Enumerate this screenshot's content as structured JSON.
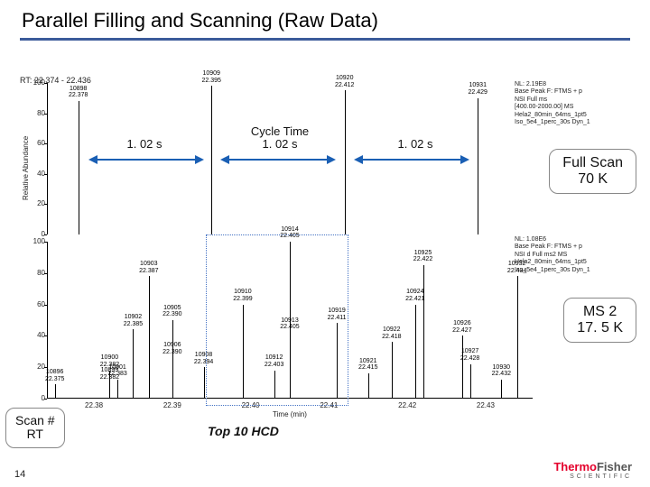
{
  "title": "Parallel Filling and Scanning (Raw Data)",
  "rt_range": "RT: 22.374 - 22.436",
  "ylabel": "Relative Abundance",
  "xlabel": "Time (min)",
  "cycle_label": "Cycle Time",
  "cycle_times": [
    "1. 02 s",
    "1. 02 s",
    "1. 02 s"
  ],
  "pills": {
    "fullscan": "Full Scan\n70 K",
    "ms2": "MS 2\n17. 5 K"
  },
  "scan_rt": "Scan #\nRT",
  "top10": "Top 10 HCD",
  "page_num": "14",
  "logo": {
    "thermo": "Thermo",
    "fisher": "Fisher",
    "sci": "SCIENTIFIC"
  },
  "info_top": "NL: 2.19E8\nBase Peak F: FTMS + p\nNSI Full ms\n[400.00-2000.00]  MS\nHela2_80min_64ms_1pt5\nIso_5e4_1perc_30s Dyn_1",
  "info_bot": "NL: 1.08E6\nBase Peak F: FTMS + p\nNSI d Full ms2  MS\nHela2_80min_64ms_1pt5\nIso_5e4_1perc_30s Dyn_1",
  "chart_data": [
    {
      "type": "bar",
      "xlabel": "Time (min)",
      "ylabel": "Relative Abundance",
      "ylim": [
        0,
        100
      ],
      "yticks": [
        0,
        20,
        40,
        60,
        80,
        100
      ],
      "xticks": [
        22.38,
        22.39,
        22.4,
        22.41,
        22.42,
        22.43
      ],
      "series": [
        {
          "name": "Full Scan 70K",
          "peaks": [
            {
              "scan": 10898,
              "rt": 22.378,
              "abund": 88
            },
            {
              "scan": 10909,
              "rt": 22.395,
              "abund": 98
            },
            {
              "scan": 10920,
              "rt": 22.412,
              "abund": 95
            },
            {
              "scan": 10931,
              "rt": 22.429,
              "abund": 90
            }
          ]
        }
      ]
    },
    {
      "type": "bar",
      "xlabel": "Time (min)",
      "ylabel": "Relative Abundance",
      "ylim": [
        0,
        100
      ],
      "yticks": [
        0,
        20,
        40,
        60,
        80,
        100
      ],
      "xticks": [
        22.38,
        22.39,
        22.4,
        22.41,
        22.42,
        22.43
      ],
      "series": [
        {
          "name": "MS2 17.5K",
          "peaks": [
            {
              "scan": 10896,
              "rt": 22.375,
              "abund": 9
            },
            {
              "scan": 10899,
              "rt": 22.382,
              "abund": 10
            },
            {
              "scan": 10900,
              "rt": 22.382,
              "abund": 18
            },
            {
              "scan": 10901,
              "rt": 22.383,
              "abund": 12
            },
            {
              "scan": 10902,
              "rt": 22.385,
              "abund": 44
            },
            {
              "scan": 10903,
              "rt": 22.387,
              "abund": 78
            },
            {
              "scan": 10905,
              "rt": 22.39,
              "abund": 50
            },
            {
              "scan": 10906,
              "rt": 22.39,
              "abund": 26
            },
            {
              "scan": 10908,
              "rt": 22.394,
              "abund": 20
            },
            {
              "scan": 10910,
              "rt": 22.399,
              "abund": 60
            },
            {
              "scan": 10912,
              "rt": 22.403,
              "abund": 18
            },
            {
              "scan": 10913,
              "rt": 22.405,
              "abund": 42
            },
            {
              "scan": 10914,
              "rt": 22.405,
              "abund": 100
            },
            {
              "scan": 10919,
              "rt": 22.411,
              "abund": 48
            },
            {
              "scan": 10921,
              "rt": 22.415,
              "abund": 16
            },
            {
              "scan": 10922,
              "rt": 22.418,
              "abund": 36
            },
            {
              "scan": 10924,
              "rt": 22.421,
              "abund": 60
            },
            {
              "scan": 10925,
              "rt": 22.422,
              "abund": 85
            },
            {
              "scan": 10926,
              "rt": 22.427,
              "abund": 40
            },
            {
              "scan": 10927,
              "rt": 22.428,
              "abund": 22
            },
            {
              "scan": 10930,
              "rt": 22.432,
              "abund": 12
            },
            {
              "scan": 10932,
              "rt": 22.434,
              "abund": 78
            }
          ]
        }
      ]
    }
  ]
}
